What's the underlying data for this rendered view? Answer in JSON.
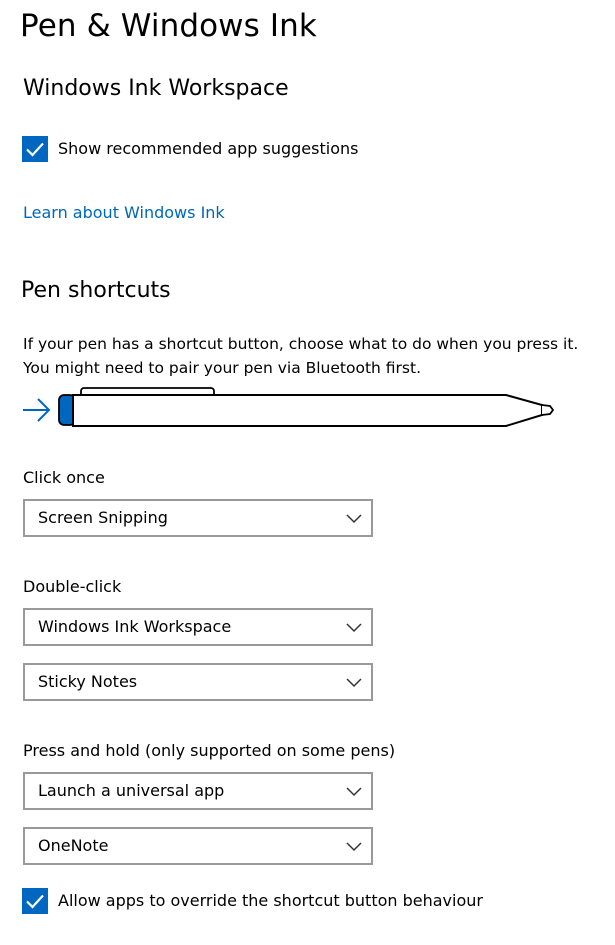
{
  "page": {
    "title": "Pen & Windows Ink"
  },
  "ink_workspace": {
    "heading": "Windows Ink Workspace",
    "suggestions_label": "Show recommended app suggestions",
    "suggestions_checked": true,
    "learn_link": "Learn about Windows Ink"
  },
  "pen_shortcuts": {
    "heading": "Pen shortcuts",
    "description_line1": "If your pen has a shortcut button, choose what to do when you press it.",
    "description_line2": "You might need to pair your pen via Bluetooth first.",
    "click_once": {
      "label": "Click once",
      "selected": "Screen Snipping"
    },
    "double_click": {
      "label": "Double-click",
      "selected": "Windows Ink Workspace",
      "app_selected": "Sticky Notes"
    },
    "press_hold": {
      "label": "Press and hold (only supported on some pens)",
      "selected": "Launch a universal app",
      "app_selected": "OneNote"
    },
    "override_label": "Allow apps to override the shortcut button behaviour",
    "override_checked": true
  },
  "colors": {
    "accent": "#0067c0",
    "link": "#0067b8",
    "dropdown_border": "#999999"
  }
}
